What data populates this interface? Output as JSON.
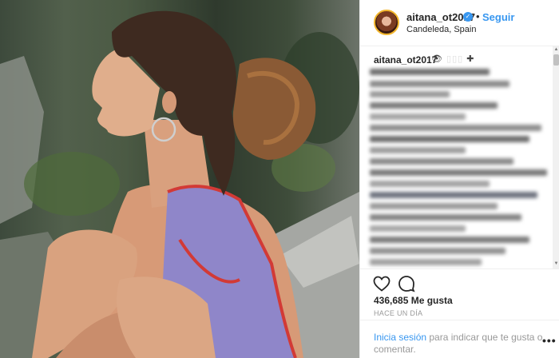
{
  "post": {
    "username": "aitana_ot2017",
    "verified_mark": "✓",
    "separator": "•",
    "follow_label": "Seguir",
    "location": "Candeleda, Spain"
  },
  "caption": {
    "username": "aitana_ot2017",
    "emoji_visible": "👁",
    "emoji_trailing": "✚"
  },
  "engagement": {
    "likes_text": "436,685 Me gusta",
    "timestamp": "HACE UN DÍA"
  },
  "login_prompt": {
    "link_label": "Inicia sesión",
    "rest_text": " para indicar que te gusta o comentar."
  },
  "more_label": "•••",
  "icons": [
    "heart-icon",
    "comment-icon",
    "verified-icon",
    "more-options-icon"
  ],
  "colors": {
    "accent": "#3897f0",
    "text": "#262626",
    "muted": "#999999",
    "border": "#efefef"
  }
}
